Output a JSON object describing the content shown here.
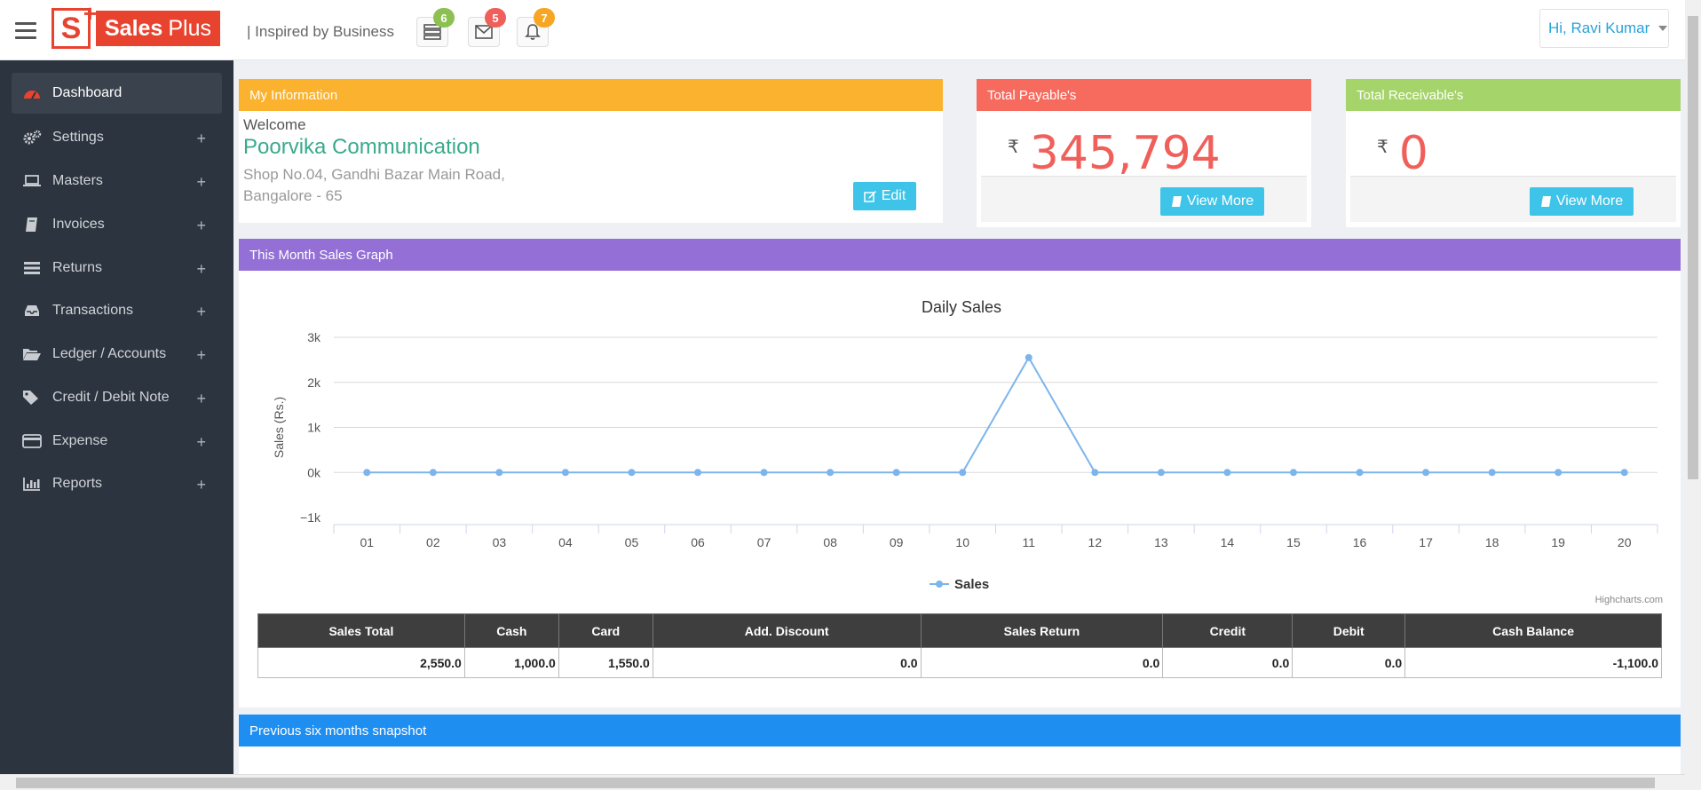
{
  "app": {
    "logo_letter": "S",
    "logo_name_bold": "Sales",
    "logo_name": "Plus",
    "tagline": "| Inspired by Business",
    "brand_color": "#e8432f"
  },
  "notifications": [
    {
      "icon": "server-icon",
      "count": "6",
      "color": "#8cc152"
    },
    {
      "icon": "envelope-icon",
      "count": "5",
      "color": "#f0605b"
    },
    {
      "icon": "bell-icon",
      "count": "7",
      "color": "#f6a623"
    }
  ],
  "user": {
    "greeting": "Hi, Ravi Kumar"
  },
  "sidebar": {
    "items": [
      {
        "label": "Dashboard",
        "icon": "dashboard-icon",
        "active": true,
        "expandable": false
      },
      {
        "label": "Settings",
        "icon": "gears-icon",
        "expandable": true,
        "expand": "+"
      },
      {
        "label": "Masters",
        "icon": "laptop-icon",
        "expandable": true,
        "expand": "+"
      },
      {
        "label": "Invoices",
        "icon": "book-icon",
        "expandable": true,
        "expand": "+"
      },
      {
        "label": "Returns",
        "icon": "list-icon",
        "expandable": true,
        "expand": "+"
      },
      {
        "label": "Transactions",
        "icon": "inbox-icon",
        "expandable": true,
        "expand": "+"
      },
      {
        "label": "Ledger / Accounts",
        "icon": "folder-open-icon",
        "expandable": true,
        "expand": "+"
      },
      {
        "label": "Credit / Debit Note",
        "icon": "tags-icon",
        "expandable": true,
        "expand": "+"
      },
      {
        "label": "Expense",
        "icon": "credit-card-icon",
        "expandable": true,
        "expand": "+"
      },
      {
        "label": "Reports",
        "icon": "bar-chart-icon",
        "expandable": true,
        "expand": "+"
      }
    ]
  },
  "my_info": {
    "title": "My Information",
    "welcome": "Welcome",
    "company": "Poorvika Communication",
    "address_line1": "Shop No.04, Gandhi Bazar Main Road,",
    "address_line2": "Bangalore - 65",
    "edit_label": "Edit",
    "color": "#fbb22e"
  },
  "payable": {
    "title": "Total Payable's",
    "currency": "₹",
    "amount": "345,794",
    "button": "View More",
    "color": "#f76b5e"
  },
  "receivable": {
    "title": "Total Receivable's",
    "currency": "₹",
    "amount": "0",
    "button": "View More",
    "color": "#a5d46a"
  },
  "graph_panel": {
    "title": "This Month Sales Graph",
    "color": "#9470d6"
  },
  "chart_data": {
    "type": "line",
    "title": "Daily Sales",
    "ylabel": "Sales (Rs.)",
    "xlabel": "",
    "categories": [
      "01",
      "02",
      "03",
      "04",
      "05",
      "06",
      "07",
      "08",
      "09",
      "10",
      "11",
      "12",
      "13",
      "14",
      "15",
      "16",
      "17",
      "18",
      "19",
      "20"
    ],
    "series": [
      {
        "name": "Sales",
        "values": [
          0,
          0,
          0,
          0,
          0,
          0,
          0,
          0,
          0,
          0,
          2550,
          0,
          0,
          0,
          0,
          0,
          0,
          0,
          0,
          0
        ],
        "color": "#7cb5ec"
      }
    ],
    "ylim": [
      -1000,
      3000
    ],
    "yticks": [
      -1000,
      0,
      1000,
      2000,
      3000
    ],
    "ytick_labels": [
      "−1k",
      "0k",
      "1k",
      "2k",
      "3k"
    ],
    "grid": true,
    "legend": "bottom-center",
    "credits": "Highcharts.com"
  },
  "summary_table": {
    "headers": [
      "Sales Total",
      "Cash",
      "Card",
      "Add. Discount",
      "Sales Return",
      "Credit",
      "Debit",
      "Cash Balance"
    ],
    "rows": [
      [
        "2,550.0",
        "1,000.0",
        "1,550.0",
        "0.0",
        "0.0",
        "0.0",
        "0.0",
        "-1,100.0"
      ]
    ]
  },
  "snapshot_panel": {
    "title": "Previous six months snapshot",
    "color": "#1f8ef1"
  }
}
